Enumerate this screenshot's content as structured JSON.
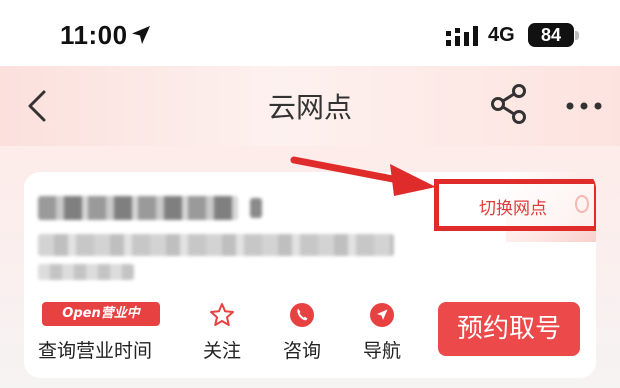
{
  "status_bar": {
    "time": "11:00",
    "network": "4G",
    "battery": "84"
  },
  "nav": {
    "title": "云网点",
    "back_icon": "chevron-left-icon",
    "share_icon": "share-icon",
    "more_icon": "more-dots-icon"
  },
  "card": {
    "switch_label": "切换网点",
    "open_badge": "Open营业中",
    "hours_label": "查询营业时间",
    "actions": [
      {
        "label": "关注",
        "icon": "star-icon"
      },
      {
        "label": "咨询",
        "icon": "phone-icon"
      },
      {
        "label": "导航",
        "icon": "navigation-icon"
      }
    ],
    "book_label": "预约取号"
  },
  "colors": {
    "accent": "#e84141",
    "annotation": "#e02b2b"
  }
}
